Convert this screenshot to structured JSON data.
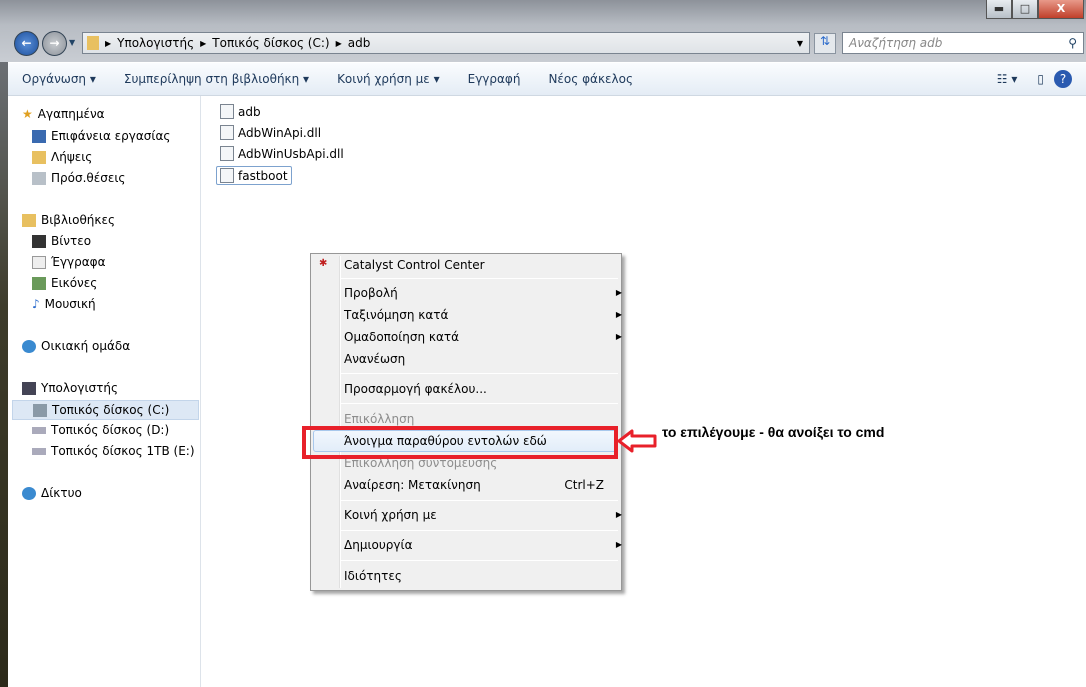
{
  "window": {
    "minimize": "▬",
    "maximize": "□",
    "close": "X"
  },
  "address": {
    "crumbs": [
      "Υπολογιστής",
      "Τοπικός δίσκος (C:)",
      "adb"
    ],
    "search_placeholder": "Αναζήτηση adb"
  },
  "toolbar": {
    "organize": "Οργάνωση ▾",
    "include": "Συμπερίληψη στη βιβλιοθήκη ▾",
    "share": "Κοινή χρήση με ▾",
    "burn": "Εγγραφή",
    "new_folder": "Νέος φάκελος"
  },
  "sidebar": {
    "favorites": "Αγαπημένα",
    "fav_items": [
      "Επιφάνεια εργασίας",
      "Λήψεις",
      "Πρόσ.θέσεις"
    ],
    "libraries": "Βιβλιοθήκες",
    "lib_items": [
      "Βίντεο",
      "Έγγραφα",
      "Εικόνες",
      "Μουσική"
    ],
    "homegroup": "Οικιακή ομάδα",
    "computer": "Υπολογιστής",
    "drives": [
      "Τοπικός δίσκος (C:)",
      "Τοπικός δίσκος  (D:)",
      "Τοπικός δίσκος 1TB (E:)"
    ],
    "network": "Δίκτυο"
  },
  "files": [
    "adb",
    "AdbWinApi.dll",
    "AdbWinUsbApi.dll",
    "fastboot"
  ],
  "menu": {
    "catalyst": "Catalyst Control Center",
    "view": "Προβολή",
    "sort": "Ταξινόμηση κατά",
    "group": "Ομαδοποίηση κατά",
    "refresh": "Ανανέωση",
    "customize": "Προσαρμογή φακέλου...",
    "paste": "Επικόλληση",
    "open_cmd": "Άνοιγμα παραθύρου εντολών εδώ",
    "paste_shortcut": "Επικόλληση συντόμευσης",
    "undo": "Αναίρεση: Μετακίνηση",
    "undo_shortcut": "Ctrl+Z",
    "share": "Κοινή χρήση με",
    "new": "Δημιουργία",
    "properties": "Ιδιότητες"
  },
  "annotation": "το επιλέγουμε - θα ανοίξει το cmd",
  "colors": {
    "highlight_box": "#e8202a"
  }
}
